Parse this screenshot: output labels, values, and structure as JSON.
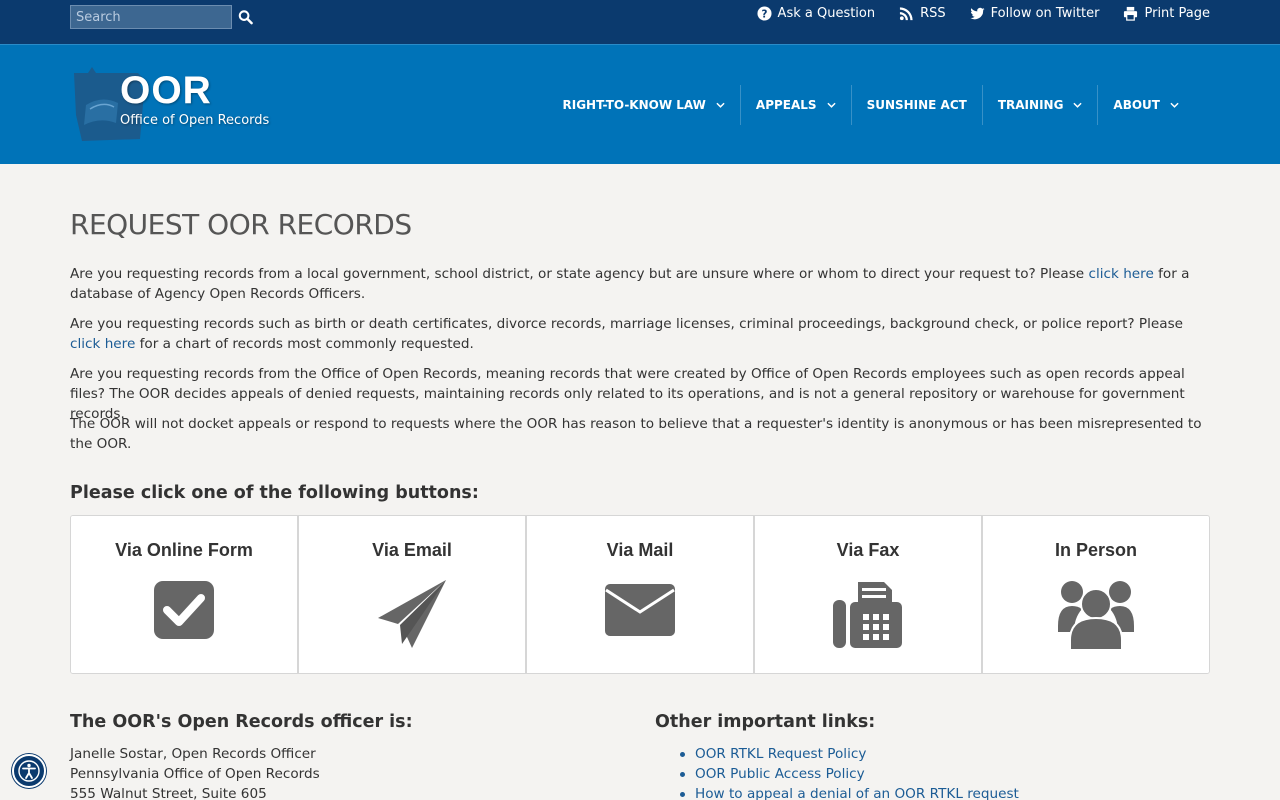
{
  "topbar": {
    "search_placeholder": "Search",
    "links": {
      "ask": "Ask a Question",
      "rss": "RSS",
      "twitter": "Follow on Twitter",
      "print": "Print Page"
    }
  },
  "header": {
    "logo_title": "OOR",
    "logo_subtitle": "Office of Open Records",
    "nav": {
      "rtk": "RIGHT-TO-KNOW LAW",
      "appeals": "APPEALS",
      "sunshine": "SUNSHINE ACT",
      "training": "TRAINING",
      "about": "ABOUT"
    }
  },
  "main": {
    "title": "REQUEST OOR RECORDS",
    "p1_before": "Are you requesting records from a local government, school district, or state agency but are unsure where or whom to direct your request to? Please ",
    "p1_link": "click here",
    "p1_after": " for a database of Agency Open Records Officers.",
    "p2_before": "Are you requesting records such as birth or death certificates, divorce records, marriage licenses, criminal proceedings, background check, or police report? Please ",
    "p2_link": "click here",
    "p2_after": " for a chart of records most commonly requested.",
    "p3": "Are you requesting records from the Office of Open Records, meaning records that were created by Office of Open Records employees such as open records appeal files? The OOR decides appeals of denied requests, maintaining records only related to its operations, and is not a general repository or warehouse for government records.",
    "p4": "The OOR will not docket appeals or respond to requests where the OOR has reason to believe that a requester's identity is anonymous or has been misrepresented to the OOR.",
    "prompt": "Please click one of the following buttons:",
    "options": {
      "online": "Via Online Form",
      "email": "Via Email",
      "mail": "Via Mail",
      "fax": "Via Fax",
      "person": "In Person"
    },
    "officer_heading": "The OOR's Open Records officer is:",
    "officer_lines": {
      "l1": "Janelle Sostar, Open Records Officer",
      "l2": "Pennsylvania Office of Open Records",
      "l3": "555 Walnut Street, Suite 605"
    },
    "links_heading": "Other important links:",
    "links": {
      "l1": "OOR RTKL Request Policy",
      "l2": "OOR Public Access Policy",
      "l3": "How to appeal a denial of an OOR RTKL request"
    }
  },
  "colors": {
    "topbar": "#0b3a6e",
    "header": "#0073b8",
    "link": "#1c5c95",
    "icon": "#666666",
    "background": "#f4f3f1"
  },
  "icons": {
    "search": "search-icon",
    "ask": "question-circle-icon",
    "rss": "rss-icon",
    "twitter": "twitter-icon",
    "print": "print-icon",
    "online": "check-square-icon",
    "email": "paper-plane-icon",
    "mail": "envelope-icon",
    "fax": "fax-icon",
    "person": "users-icon",
    "accessibility": "accessibility-icon"
  }
}
